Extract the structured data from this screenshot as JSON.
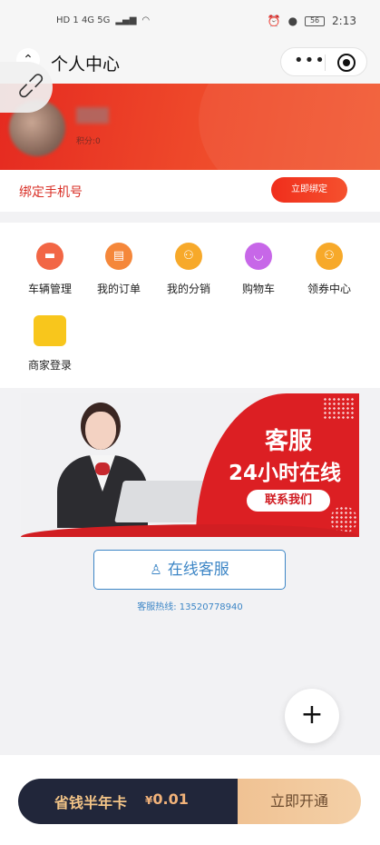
{
  "status_bar": {
    "left_text": "HD 1 4G 5G",
    "time": "2:13",
    "battery": "56"
  },
  "nav": {
    "title": "个人中心",
    "back_icon": "home-up-icon",
    "more_icon": "more-dots-icon",
    "close_icon": "target-close-icon"
  },
  "floating": {
    "icon": "link-icon"
  },
  "profile": {
    "points_label": "积分:0"
  },
  "bind_phone": {
    "label": "绑定手机号",
    "button": "立即绑定"
  },
  "menu": {
    "items": [
      {
        "label": "车辆管理",
        "icon": "truck-icon"
      },
      {
        "label": "我的订单",
        "icon": "order-icon"
      },
      {
        "label": "我的分销",
        "icon": "distribution-icon"
      },
      {
        "label": "购物车",
        "icon": "cart-icon"
      },
      {
        "label": "领券中心",
        "icon": "coupon-icon"
      },
      {
        "label": "商家登录",
        "icon": "store-icon"
      }
    ]
  },
  "ad_banner": {
    "line1": "客服",
    "line2": "24小时在线",
    "button": "联系我们"
  },
  "service": {
    "button": "在线客服",
    "hotline": "客服热线: 13520778940"
  },
  "fab": {
    "icon": "plus-icon"
  },
  "promo": {
    "name": "省钱半年卡",
    "currency": "¥",
    "price": "0.01",
    "action": "立即开通"
  },
  "colors": {
    "brand_red": "#e52a20",
    "service_blue": "#3d86c6",
    "promo_dark": "#21263a",
    "promo_gold": "#f0c293"
  }
}
